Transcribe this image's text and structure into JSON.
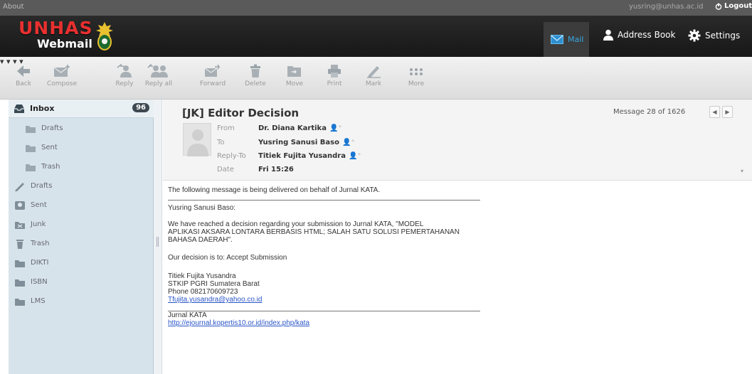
{
  "topbar": {
    "about": "About",
    "user": "yusring@unhas.ac.id",
    "logout": "Logout"
  },
  "header": {
    "logo_top": "UNHAS",
    "logo_bottom": "Webmail",
    "nav": {
      "mail": "Mail",
      "address_book": "Address Book",
      "settings": "Settings"
    }
  },
  "toolbar": {
    "back": "Back",
    "compose": "Compose",
    "reply": "Reply",
    "reply_all": "Reply all",
    "forward": "Forward",
    "delete": "Delete",
    "move": "Move",
    "print": "Print",
    "mark": "Mark",
    "more": "More"
  },
  "folders": {
    "inbox": "Inbox",
    "inbox_count": "96",
    "items": [
      "Drafts",
      "Sent",
      "Trash",
      "Drafts",
      "Sent",
      "Junk",
      "Trash",
      "DIKTI",
      "ISBN",
      "LMS"
    ]
  },
  "message": {
    "subject": "[JK] Editor Decision",
    "counter": "Message 28 of 1626",
    "labels": {
      "from": "From",
      "to": "To",
      "reply_to": "Reply-To",
      "date": "Date"
    },
    "from": "Dr. Diana Kartika",
    "to": "Yusring Sanusi Baso",
    "reply_to": "Titiek Fujita Yusandra",
    "date": "Fri 15:26"
  },
  "body": {
    "intro": "The following message is being delivered on behalf of Jurnal KATA.",
    "salutation": "Yusring Sanusi Baso:",
    "para1_l1": "We have reached a decision regarding your submission to Jurnal KATA, \"MODEL",
    "para1_l2": "APLIKASI AKSARA LONTARA BERBASIS HTML;  SALAH SATU SOLUSI PEMERTAHANAN",
    "para1_l3": "BAHASA DAERAH\".",
    "decision": "Our decision is to: Accept Submission",
    "sig_name": "Titiek Fujita Yusandra",
    "sig_org": "STKIP PGRI Sumatera Barat",
    "sig_phone": "Phone 082170609723",
    "sig_email": "Tfujita.yusandra@yahoo.co.id",
    "journal": "Jurnal KATA",
    "journal_url": "http://ejournal.kopertis10.or.id/index.php/kata"
  }
}
